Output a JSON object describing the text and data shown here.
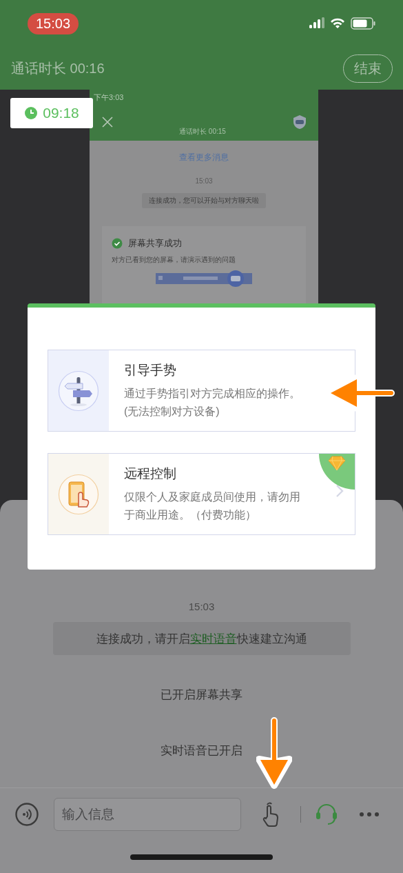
{
  "status_bar": {
    "time": "15:03"
  },
  "call_header": {
    "duration": "通话时长 00:16",
    "end_button": "结束"
  },
  "timer": "09:18",
  "shared_screen": {
    "status_time": "下午3:03",
    "title": "通话时长 00:15",
    "more_link": "查看更多消息",
    "time": "15:03",
    "notice": "连接成功，您可以开始与对方聊天啦",
    "card": {
      "title": "屏幕共享成功",
      "text": "对方已看到您的屏幕，请演示遇到的问题"
    }
  },
  "dialog": {
    "options": [
      {
        "kind": "gesture",
        "title": "引导手势",
        "lines": [
          "通过手势指引对方完成相应的操作。",
          "(无法控制对方设备)"
        ],
        "premium": false,
        "chevron": false
      },
      {
        "kind": "remote",
        "title": "远程控制",
        "lines": [
          "仅限个人及家庭成员间使用，请勿用",
          "于商业用途。（付费功能）"
        ],
        "premium": true,
        "chevron": true
      }
    ]
  },
  "chat": {
    "time": "15:03",
    "notice": {
      "before": "连接成功，请开启",
      "link": "实时语音",
      "after": "快速建立沟通"
    },
    "events": [
      "已开启屏幕共享",
      "实时语音已开启"
    ]
  },
  "input": {
    "placeholder": "输入信息"
  }
}
